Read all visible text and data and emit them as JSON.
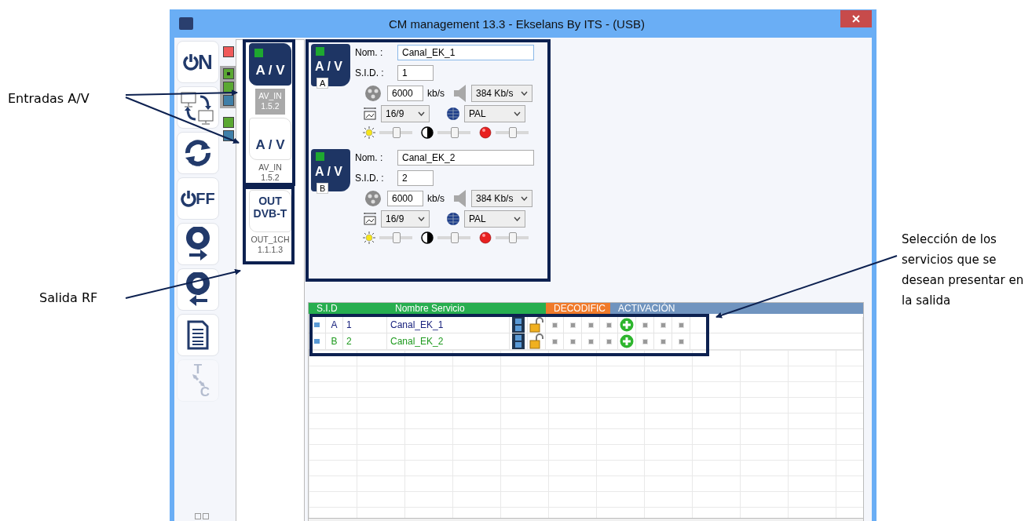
{
  "annotations": {
    "left": [
      {
        "text": "Entradas A/V"
      },
      {
        "text": "Salida RF"
      }
    ],
    "right": {
      "text": "Selección de los servicios que se desean presentar en la salida"
    }
  },
  "window": {
    "title": "CM management 13.3 - Ekselans By ITS - (USB)"
  },
  "toolbar": [
    {
      "kind": "power-on",
      "label": "N",
      "disabled": false
    },
    {
      "kind": "swap",
      "disabled": false
    },
    {
      "kind": "refresh",
      "disabled": false
    },
    {
      "kind": "power-off",
      "label": "FF",
      "disabled": false
    },
    {
      "kind": "disc-out",
      "disabled": false
    },
    {
      "kind": "disc-in",
      "disabled": false
    },
    {
      "kind": "document",
      "disabled": false
    },
    {
      "kind": "tc",
      "labels": [
        "T",
        "C"
      ],
      "disabled": true
    }
  ],
  "led_groups": [
    {
      "selected": false,
      "leds": [
        {
          "color": "#f05a5a"
        }
      ]
    },
    {
      "selected": true,
      "leds": [
        {
          "color": "#5aa832",
          "dot": true
        },
        {
          "color": "#5aa832",
          "dot": false
        },
        {
          "color": "#3f7fa8",
          "dot": false
        }
      ]
    },
    {
      "selected": false,
      "leds": [
        {
          "color": "#5aa832",
          "dot": false
        },
        {
          "color": "#3f7fa8",
          "dot": false
        }
      ]
    }
  ],
  "devices": [
    {
      "kind": "input",
      "lines": [
        "A / V"
      ],
      "led": true,
      "selected": true,
      "name": "AV_IN",
      "version": "1.5.2"
    },
    {
      "kind": "input",
      "lines": [
        "A / V"
      ],
      "led": false,
      "selected": false,
      "name": "AV_IN",
      "version": "1.5.2"
    },
    {
      "kind": "output",
      "lines": [
        "OUT",
        "DVB-T"
      ],
      "led": false,
      "selected": false,
      "name": "OUT_1CH",
      "version": "1.1.1.3"
    }
  ],
  "channels": [
    {
      "badge": "A / V",
      "letter": "A",
      "led": true,
      "name_label": "Nom. :",
      "name": "Canal_EK_1",
      "focused": true,
      "sid_label": "S.I.D. :",
      "sid": "1",
      "video_rate": "6000",
      "unit": "kb/s",
      "audio_rate": "384 Kb/s",
      "aspect": "16/9",
      "standard": "PAL",
      "brightness": {
        "level": 0.5
      },
      "contrast": {
        "level": 0.5
      },
      "color": {
        "level": 0.5
      }
    },
    {
      "badge": "A / V",
      "letter": "B",
      "led": true,
      "name_label": "Nom. :",
      "name": "Canal_EK_2",
      "focused": false,
      "sid_label": "S.I.D. :",
      "sid": "2",
      "video_rate": "6000",
      "unit": "kb/s",
      "audio_rate": "384 Kb/s",
      "aspect": "16/9",
      "standard": "PAL",
      "brightness": {
        "level": 0.5
      },
      "contrast": {
        "level": 0.5
      },
      "color": {
        "level": 0.5
      }
    }
  ],
  "table": {
    "columns": [
      {
        "label": "S.I.D",
        "color": "#27ae4f"
      },
      {
        "label": "Nombre Servicio",
        "color": "#27ae4f"
      },
      {
        "label": "DECODIFIC",
        "color": "#f07a2a"
      },
      {
        "label": "ACTIVACIÓN",
        "color": "#7094bf"
      }
    ],
    "rows": [
      {
        "letter": "A",
        "sid": "1",
        "name": "Canal_EK_1",
        "color": "#1a237e",
        "decode": [
          false,
          false,
          false,
          false
        ],
        "activation": [
          true,
          false,
          false,
          false
        ]
      },
      {
        "letter": "B",
        "sid": "2",
        "name": "Canal_EK_2",
        "color": "#1e9a1e",
        "decode": [
          false,
          false,
          false,
          false
        ],
        "activation": [
          true,
          false,
          false,
          false
        ]
      }
    ]
  }
}
